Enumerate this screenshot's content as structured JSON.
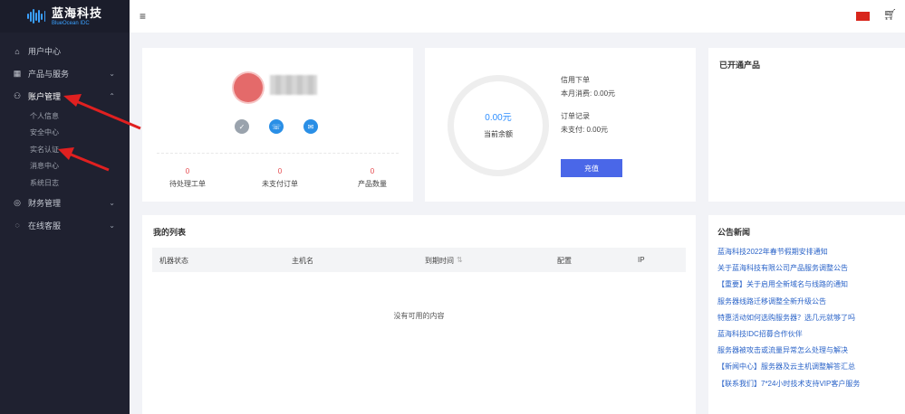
{
  "brand": {
    "name_cn": "蓝海科技",
    "name_en": "BlueOcean",
    "name_en_suffix": "IDC"
  },
  "sidebar": {
    "items": [
      {
        "label": "用户中心",
        "icon": "home-icon"
      },
      {
        "label": "产品与服务",
        "icon": "grid-icon"
      },
      {
        "label": "账户管理",
        "icon": "user-icon"
      },
      {
        "label": "财务管理",
        "icon": "finance-icon"
      },
      {
        "label": "在线客服",
        "icon": "chat-icon"
      }
    ],
    "account_sub": [
      "个人信息",
      "安全中心",
      "实名认证",
      "消息中心",
      "系统日志"
    ]
  },
  "user": {
    "stats": [
      {
        "value": "0",
        "label": "待处理工单"
      },
      {
        "value": "0",
        "label": "未支付订单"
      },
      {
        "value": "0",
        "label": "产品数量"
      }
    ]
  },
  "balance": {
    "amount": "0.00元",
    "label": "当前余额",
    "plan_line": "信用下单",
    "consume_line": "本月消费: 0.00元",
    "orders_line": "订单记录",
    "unpaid_line": "未支付: 0.00元",
    "charge_button": "充值"
  },
  "products": {
    "title": "已开通产品"
  },
  "orders": {
    "title": "我的列表",
    "columns": [
      "机器状态",
      "主机名",
      "到期时间",
      "配置",
      "IP"
    ],
    "empty_text": "没有可用的内容"
  },
  "news": {
    "title": "公告新闻",
    "items": [
      "蓝海科技2022年春节假期安排通知",
      "关于蓝海科技有限公司产品服务调整公告",
      "【重要】关于启用全新域名与线路的通知",
      "服务器线路迁移调整全新升级公告",
      "特惠活动如何选购服务器？选几元就够了吗",
      "蓝海科技IDC招募合作伙伴",
      "服务器被攻击或流量异常怎么处理与解决",
      "【新闻中心】服务器及云主机调整解答汇总",
      "【联系我们】7*24小时技术支持VIP客户服务"
    ]
  }
}
